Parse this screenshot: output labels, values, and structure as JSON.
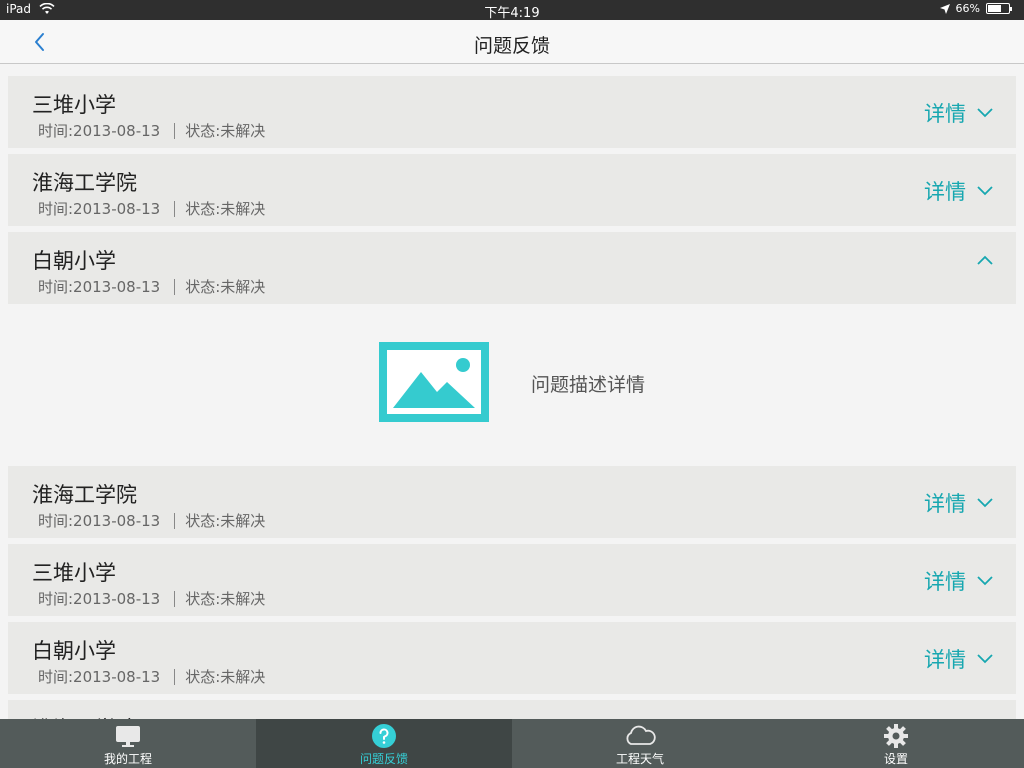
{
  "status_bar": {
    "device": "iPad",
    "time": "下午4:19",
    "battery": "66%",
    "battery_level": 0.66
  },
  "nav": {
    "title": "问题反馈"
  },
  "list": [
    {
      "name": "三堆小学",
      "time": "时间:2013-08-13",
      "status": "状态:未解决",
      "detail": "详情",
      "expanded": false
    },
    {
      "name": "淮海工学院",
      "time": "时间:2013-08-13",
      "status": "状态:未解决",
      "detail": "详情",
      "expanded": false
    },
    {
      "name": "白朝小学",
      "time": "时间:2013-08-13",
      "status": "状态:未解决",
      "detail": "",
      "expanded": true,
      "description": "问题描述详情"
    },
    {
      "name": "淮海工学院",
      "time": "时间:2013-08-13",
      "status": "状态:未解决",
      "detail": "详情",
      "expanded": false
    },
    {
      "name": "三堆小学",
      "time": "时间:2013-08-13",
      "status": "状态:未解决",
      "detail": "详情",
      "expanded": false
    },
    {
      "name": "白朝小学",
      "time": "时间:2013-08-13",
      "status": "状态:未解决",
      "detail": "详情",
      "expanded": false
    },
    {
      "name": "淮海工学院",
      "time": "",
      "status": "",
      "detail": "",
      "expanded": false
    }
  ],
  "tabs": [
    {
      "label": "我的工程",
      "icon": "monitor-icon",
      "active": false
    },
    {
      "label": "问题反馈",
      "icon": "question-icon",
      "active": true
    },
    {
      "label": "工程天气",
      "icon": "cloud-icon",
      "active": false
    },
    {
      "label": "设置",
      "icon": "gear-icon",
      "active": false
    }
  ],
  "colors": {
    "accent": "#17a7b0",
    "tab_active": "#35cfd6",
    "tab_bg": "#535b5a",
    "row_bg": "#e9e9e7"
  }
}
